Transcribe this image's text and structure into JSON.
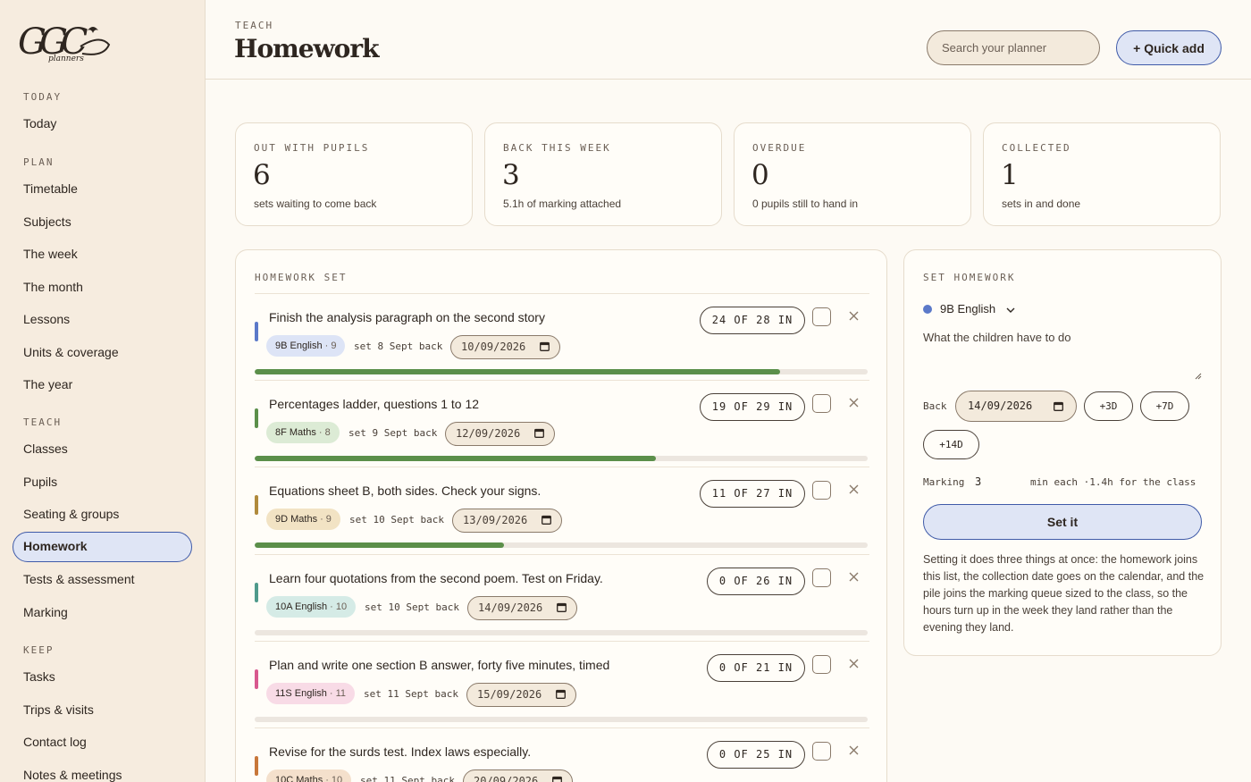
{
  "brand": {
    "logo_text": "GGC",
    "logo_sub": "planners"
  },
  "sidebar": {
    "sections": [
      {
        "label": "TODAY",
        "items": [
          "Today"
        ]
      },
      {
        "label": "PLAN",
        "items": [
          "Timetable",
          "Subjects",
          "The week",
          "The month",
          "Lessons",
          "Units & coverage",
          "The year"
        ]
      },
      {
        "label": "TEACH",
        "items": [
          "Classes",
          "Pupils",
          "Seating & groups",
          "Homework",
          "Tests & assessment",
          "Marking"
        ]
      },
      {
        "label": "KEEP",
        "items": [
          "Tasks",
          "Trips & visits",
          "Contact log",
          "Notes & meetings"
        ]
      }
    ],
    "active_item": "Homework"
  },
  "header": {
    "eyebrow": "TEACH",
    "title": "Homework",
    "search_placeholder": "Search your planner",
    "quick_add_label": "+ Quick add"
  },
  "stats": [
    {
      "label": "OUT WITH PUPILS",
      "value": "6",
      "sub": "sets waiting to come back"
    },
    {
      "label": "BACK THIS WEEK",
      "value": "3",
      "sub": "5.1h of marking attached"
    },
    {
      "label": "OVERDUE",
      "value": "0",
      "sub": "0 pupils still to hand in"
    },
    {
      "label": "COLLECTED",
      "value": "1",
      "sub": "sets in and done"
    }
  ],
  "homework_list": {
    "title": "HOMEWORK SET",
    "set_word": "set",
    "back_word": "back",
    "rows": [
      {
        "title": "Finish the analysis paragraph on the second story",
        "class": "9B English",
        "class_num": "· 9",
        "color": "#5b79c9",
        "tag_bg": "#dde4f6",
        "set_date": "8 Sept",
        "back_date": "10/09/2026",
        "handed_in": "24 OF 28 IN",
        "progress": 0.857
      },
      {
        "title": "Percentages ladder, questions 1 to 12",
        "class": "8F Maths",
        "class_num": "· 8",
        "color": "#5b8f4a",
        "tag_bg": "#dcebd5",
        "set_date": "9 Sept",
        "back_date": "12/09/2026",
        "handed_in": "19 OF 29 IN",
        "progress": 0.655
      },
      {
        "title": "Equations sheet B, both sides. Check your signs.",
        "class": "9D Maths",
        "class_num": "· 9",
        "color": "#b08a3c",
        "tag_bg": "#f2e3c4",
        "set_date": "10 Sept",
        "back_date": "13/09/2026",
        "handed_in": "11 OF 27 IN",
        "progress": 0.407
      },
      {
        "title": "Learn four quotations from the second poem. Test on Friday.",
        "class": "10A English",
        "class_num": "· 10",
        "color": "#4f9a8c",
        "tag_bg": "#d5ebe6",
        "set_date": "10 Sept",
        "back_date": "14/09/2026",
        "handed_in": "0 OF 26 IN",
        "progress": 0
      },
      {
        "title": "Plan and write one section B answer, forty five minutes, timed",
        "class": "11S English",
        "class_num": "· 11",
        "color": "#d8588e",
        "tag_bg": "#f8dbe6",
        "set_date": "11 Sept",
        "back_date": "15/09/2026",
        "handed_in": "0 OF 21 IN",
        "progress": 0
      },
      {
        "title": "Revise for the surds test. Index laws especially.",
        "class": "10C Maths",
        "class_num": "· 10",
        "color": "#c8773a",
        "tag_bg": "#f4e0cc",
        "set_date": "11 Sept",
        "back_date": "20/09/2026",
        "handed_in": "0 OF 25 IN",
        "progress": 0
      }
    ]
  },
  "set_homework": {
    "title": "SET HOMEWORK",
    "class": "9B English",
    "class_color": "#5b79c9",
    "task_placeholder": "What the children have to do",
    "back_label": "Back",
    "back_date": "14/09/2026",
    "chips": [
      "+3D",
      "+7D",
      "+14D"
    ],
    "marking_label": "Marking",
    "marking_value": "3",
    "marking_hint": "min each ·1.4h for the class",
    "submit_label": "Set it",
    "explanation": "Setting it does three things at once: the homework joins this list, the collection date goes on the calendar, and the pile joins the marking queue sized to the class, so the hours turn up in the week they land rather than the evening they land."
  }
}
